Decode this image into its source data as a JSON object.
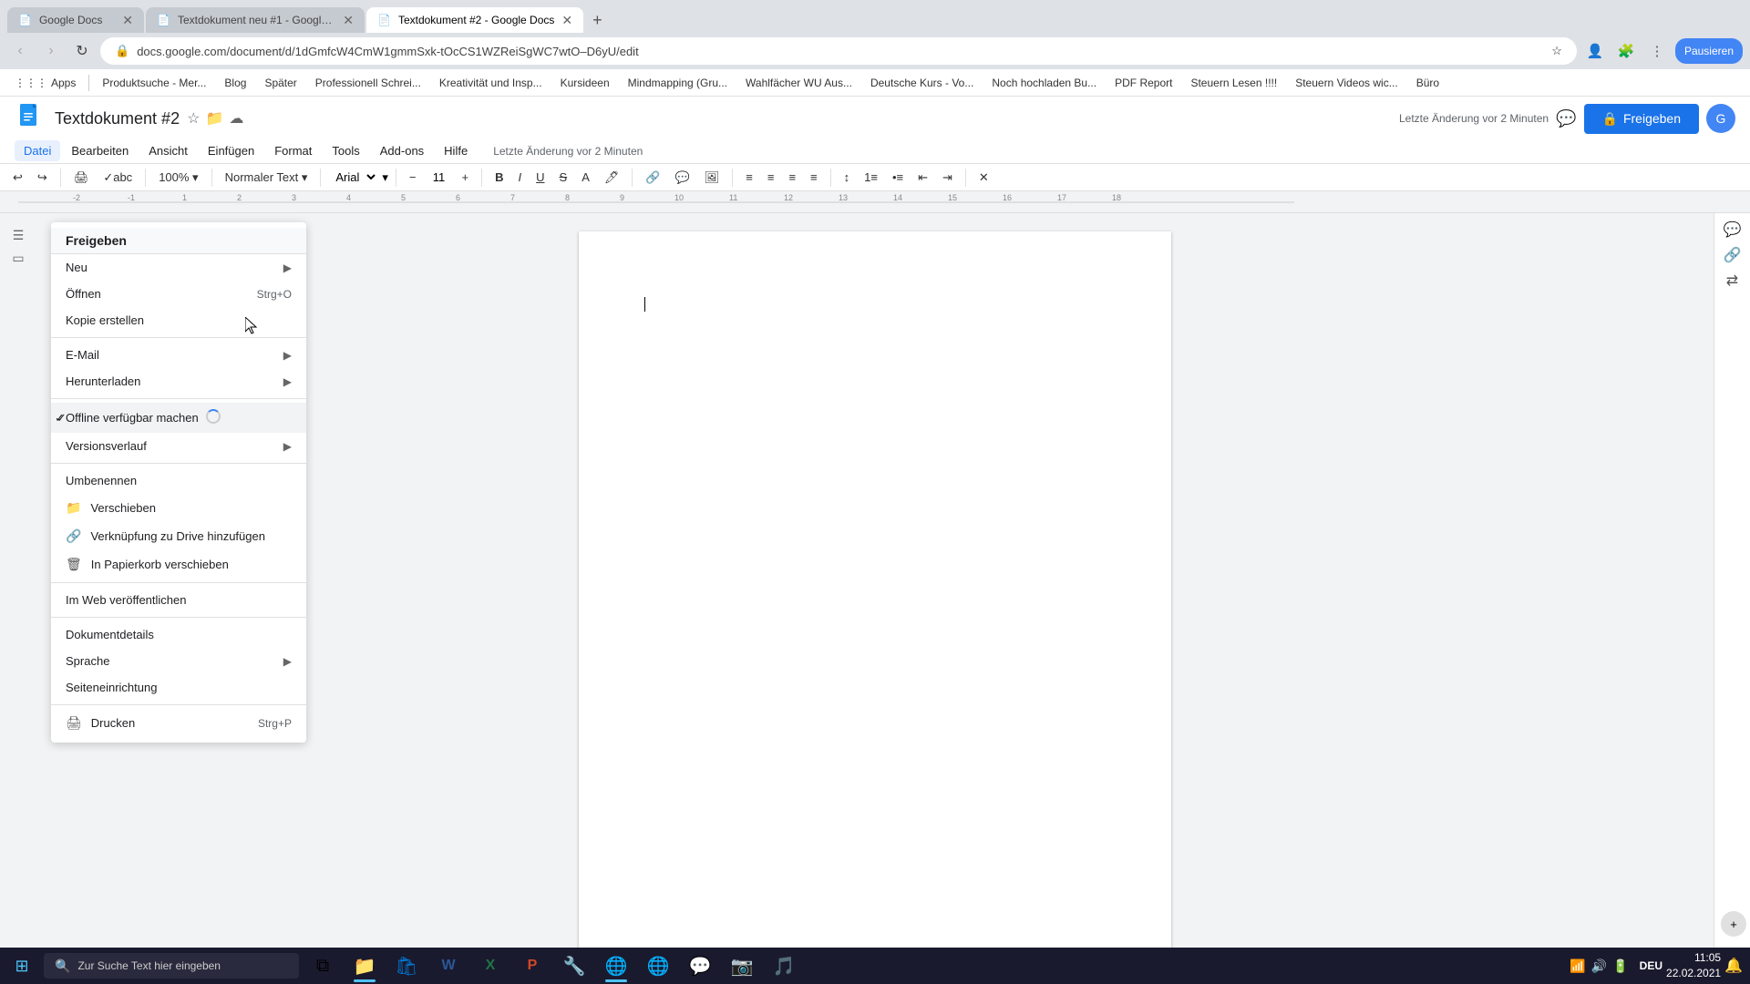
{
  "browser": {
    "tabs": [
      {
        "id": "tab1",
        "title": "Google Docs",
        "favicon": "📄",
        "active": false
      },
      {
        "id": "tab2",
        "title": "Textdokument neu #1 - Google ...",
        "favicon": "📄",
        "active": false
      },
      {
        "id": "tab3",
        "title": "Textdokument #2 - Google Docs",
        "favicon": "📄",
        "active": true
      }
    ],
    "address": "docs.google.com/document/d/1dGmfcW4CmW1gmmSxk-tOcCS1WZReiSgWC7wtO–D6yU/edit",
    "bookmarks": [
      {
        "label": "Apps"
      },
      {
        "label": "Produktsuche - Mer..."
      },
      {
        "label": "Blog"
      },
      {
        "label": "Später"
      },
      {
        "label": "Professionell Schrei..."
      },
      {
        "label": "Kreativität und Insp..."
      },
      {
        "label": "Kursideen"
      },
      {
        "label": "Mindmapping (Gru..."
      },
      {
        "label": "Wahlfächer WU Aus..."
      },
      {
        "label": "Deutsche Kurs - Vo..."
      },
      {
        "label": "Noch hochladen Bu..."
      },
      {
        "label": "PDF Report"
      },
      {
        "label": "Steuern Lesen !!!!"
      },
      {
        "label": "Steuern Videos wic..."
      },
      {
        "label": "Büro"
      }
    ]
  },
  "docs": {
    "title": "Textdokument #2",
    "last_saved": "Letzte Änderung vor 2 Minuten",
    "share_label": "Freigeben",
    "menu_items": [
      "Datei",
      "Bearbeiten",
      "Ansicht",
      "Einfügen",
      "Format",
      "Tools",
      "Add-ons",
      "Hilfe"
    ],
    "active_menu": "Datei"
  },
  "toolbar": {
    "font": "Arial",
    "font_size": "11",
    "undo_label": "↩",
    "redo_label": "↪"
  },
  "file_menu": {
    "header": "Freigeben",
    "items": [
      {
        "label": "Neu",
        "has_arrow": true,
        "shortcut": "",
        "icon": "",
        "checked": false
      },
      {
        "label": "Öffnen",
        "has_arrow": false,
        "shortcut": "Strg+O",
        "icon": "",
        "checked": false
      },
      {
        "label": "Kopie erstellen",
        "has_arrow": false,
        "shortcut": "",
        "icon": "",
        "checked": false
      },
      {
        "label": "E-Mail",
        "has_arrow": true,
        "shortcut": "",
        "icon": "",
        "checked": false
      },
      {
        "label": "Herunterladen",
        "has_arrow": true,
        "shortcut": "",
        "icon": "",
        "checked": false
      },
      {
        "label": "Offline verfügbar machen",
        "has_arrow": false,
        "shortcut": "",
        "icon": "loading",
        "checked": true
      },
      {
        "label": "Versionsverlauf",
        "has_arrow": true,
        "shortcut": "",
        "icon": "",
        "checked": false
      },
      {
        "label": "Umbenennen",
        "has_arrow": false,
        "shortcut": "",
        "icon": "",
        "checked": false
      },
      {
        "label": "Verschieben",
        "has_arrow": false,
        "shortcut": "",
        "icon": "folder",
        "checked": false
      },
      {
        "label": "Verknüpfung zu Drive hinzufügen",
        "has_arrow": false,
        "shortcut": "",
        "icon": "link",
        "checked": false
      },
      {
        "label": "In Papierkorb verschieben",
        "has_arrow": false,
        "shortcut": "",
        "icon": "trash",
        "checked": false
      },
      {
        "label": "Im Web veröffentlichen",
        "has_arrow": false,
        "shortcut": "",
        "icon": "",
        "checked": false
      },
      {
        "label": "Dokumentdetails",
        "has_arrow": false,
        "shortcut": "",
        "icon": "",
        "checked": false
      },
      {
        "label": "Sprache",
        "has_arrow": true,
        "shortcut": "",
        "icon": "",
        "checked": false
      },
      {
        "label": "Seiteneinrichtung",
        "has_arrow": false,
        "shortcut": "",
        "icon": "",
        "checked": false
      },
      {
        "label": "Drucken",
        "has_arrow": false,
        "shortcut": "Strg+P",
        "icon": "print",
        "checked": false
      }
    ]
  },
  "taskbar": {
    "search_placeholder": "Zur Suche Text hier eingeben",
    "time": "11:05",
    "date": "22.02.2021",
    "lang": "DEU",
    "apps": [
      "🪟",
      "☰",
      "📁",
      "💻",
      "W",
      "X",
      "P",
      "🎯",
      "🔧",
      "🌐",
      "🎵",
      "🎮",
      "📱",
      "🎸"
    ]
  }
}
